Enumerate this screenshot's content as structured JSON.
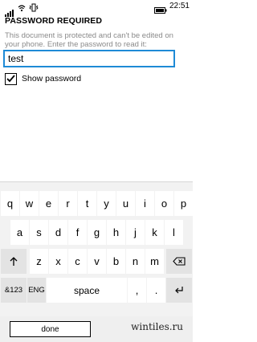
{
  "status_bar": {
    "time": "22:51",
    "icons": [
      "signal-bars-icon",
      "wifi-icon",
      "vibrate-icon",
      "battery-icon"
    ]
  },
  "dialog": {
    "title": "PASSWORD REQUIRED",
    "description": "This document is protected and can't be edited on your phone. Enter the password to read it:",
    "password_value": "test",
    "show_password_label": "Show password",
    "show_password_checked": true
  },
  "keyboard": {
    "row1": [
      "q",
      "w",
      "e",
      "r",
      "t",
      "y",
      "u",
      "i",
      "o",
      "p"
    ],
    "row2": [
      "a",
      "s",
      "d",
      "f",
      "g",
      "h",
      "j",
      "k",
      "l"
    ],
    "row3": [
      "z",
      "x",
      "c",
      "v",
      "b",
      "n",
      "m"
    ],
    "shift_icon": "shift-arrow-icon",
    "backspace_icon": "backspace-icon",
    "num_label": "&123",
    "lang_label": "ENG",
    "space_label": "space",
    "comma_label": ",",
    "period_label": ".",
    "enter_icon": "enter-icon"
  },
  "app_bar": {
    "done_label": "done"
  },
  "watermark": "wintiles.ru"
}
